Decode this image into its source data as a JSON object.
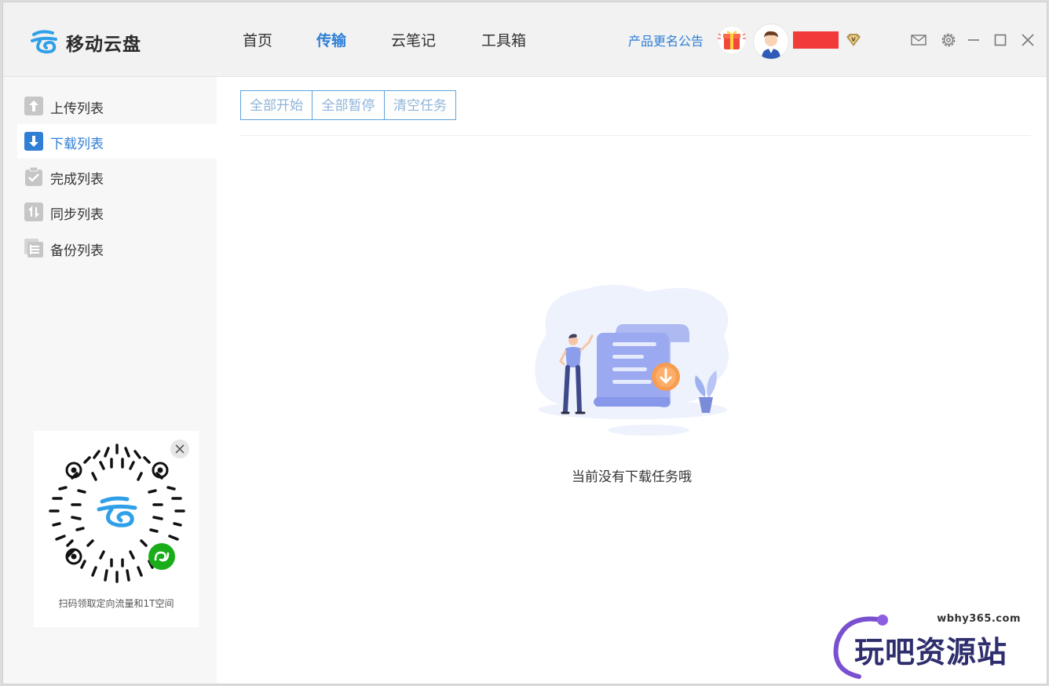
{
  "header": {
    "app_name": "移动云盘",
    "nav_tabs": [
      {
        "label": "首页",
        "active": false
      },
      {
        "label": "传输",
        "active": true
      },
      {
        "label": "云笔记",
        "active": false
      },
      {
        "label": "工具箱",
        "active": false
      }
    ],
    "announcement": "产品更名公告",
    "icons": [
      "logo-icon",
      "gift-icon",
      "avatar",
      "vip-badge-icon",
      "mail-icon",
      "settings-icon",
      "minimize-icon",
      "maximize-icon",
      "close-icon"
    ]
  },
  "sidebar": {
    "items": [
      {
        "label": "上传列表",
        "icon": "upload-icon",
        "active": false
      },
      {
        "label": "下载列表",
        "icon": "download-icon",
        "active": true
      },
      {
        "label": "完成列表",
        "icon": "complete-icon",
        "active": false
      },
      {
        "label": "同步列表",
        "icon": "sync-icon",
        "active": false
      },
      {
        "label": "备份列表",
        "icon": "backup-icon",
        "active": false
      }
    ],
    "qr_card": {
      "caption": "扫码领取定向流量和1T空间"
    }
  },
  "main": {
    "toolbar": {
      "start_all": "全部开始",
      "pause_all": "全部暂停",
      "clear_tasks": "清空任务"
    },
    "empty_message": "当前没有下载任务哦"
  },
  "watermark": {
    "url": "wbhy365.com",
    "text": "玩吧资源站"
  },
  "colors": {
    "accent": "#2f7fd5",
    "button_border": "#5fa3dc",
    "button_text": "#8fb4d8"
  }
}
